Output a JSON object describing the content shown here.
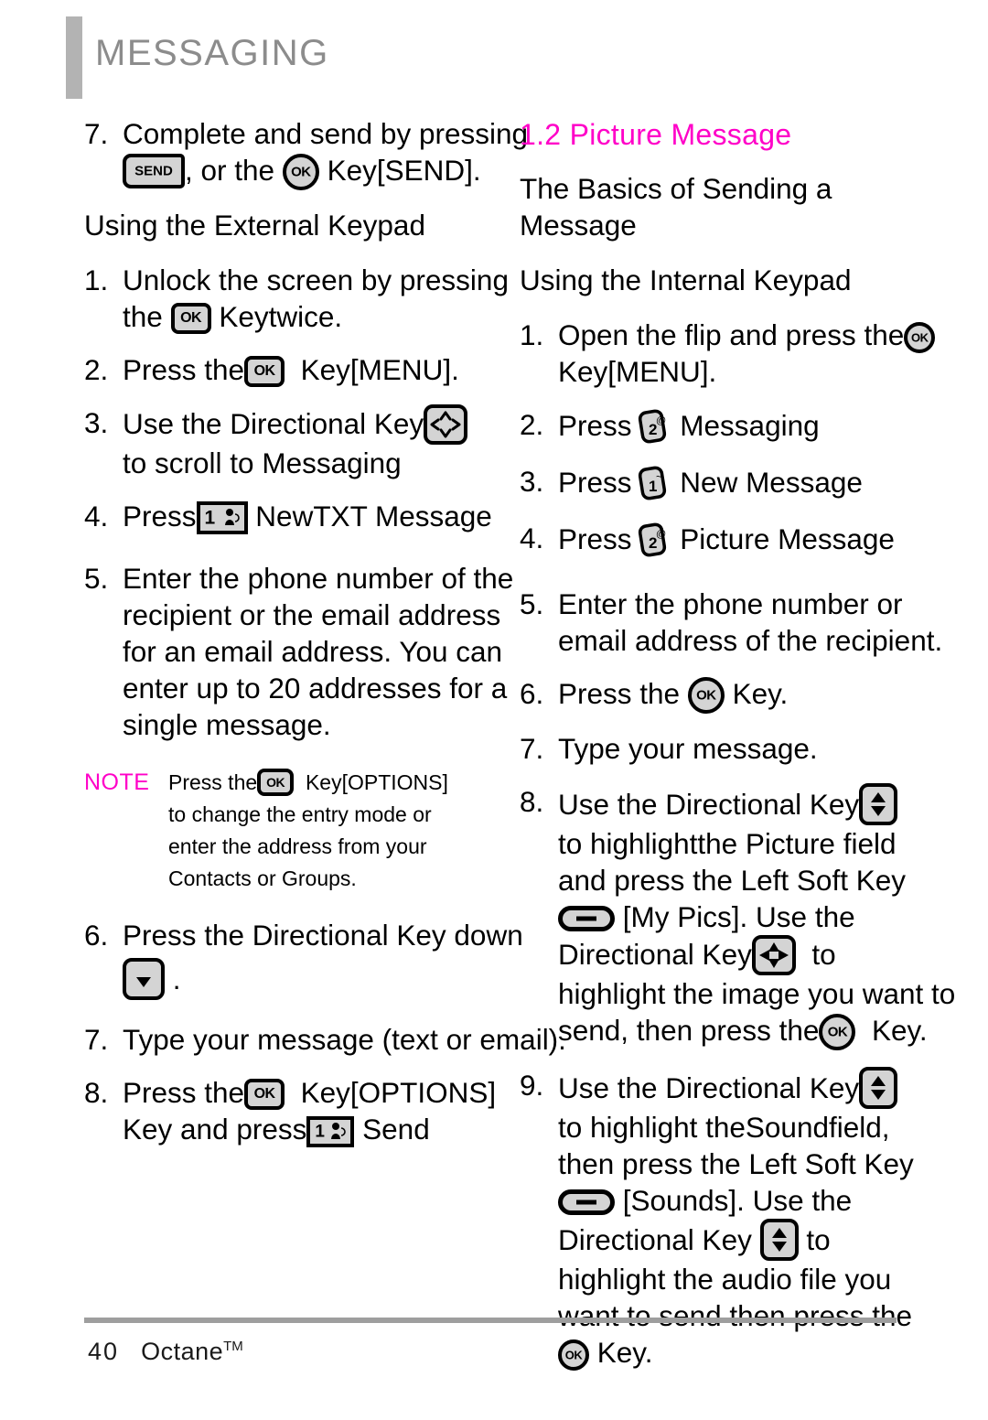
{
  "header": {
    "title": "MESSAGING"
  },
  "left_column": {
    "step7": {
      "num": "7.",
      "line1": "Complete and send by pressing",
      "line2_a": ", or the",
      "line2_b": "Key",
      "line2_c": "[SEND].",
      "key_send": "SEND",
      "key_ok": "OK"
    },
    "subheading": "Using the External Keypad",
    "step1": {
      "num": "1.",
      "line1": "Unlock the screen by pressing",
      "line2_a": "the",
      "line2_b": "Key",
      "line2_c": "twice.",
      "key_ok": "OK"
    },
    "step2": {
      "num": "2.",
      "line1_a": "Press the",
      "line1_b": "Key",
      "line1_c": "[MENU].",
      "key_ok": "OK"
    },
    "step3": {
      "num": "3.",
      "line1": "Use the Directional Key",
      "line2_a": "to scroll to",
      "line2_b": "Messaging"
    },
    "step4": {
      "num": "4.",
      "line1_a": "Press",
      "line1_b": "New",
      "line1_c": "TXT Message",
      "key_digit": "1"
    },
    "step5": {
      "num": "5.",
      "line1": "Enter the phone number of the",
      "line2": "recipient or the email address",
      "line3": "for an email address. You can",
      "line4": "enter up to 20 addresses for a",
      "line5": "single message."
    },
    "note": {
      "label": "NOTE",
      "line1_a": "Press the",
      "line1_b": "Key",
      "line1_c": "[OPTIONS]",
      "line2": "to change the entry mode or",
      "line3": "enter the address from your",
      "line4": "Contacts or Groups.",
      "key_ok": "OK"
    },
    "step6": {
      "num": "6.",
      "line1": "Press the Directional Key down",
      "line2": "."
    },
    "step7b": {
      "num": "7.",
      "line1": "Type your message (text or email)."
    },
    "step8": {
      "num": "8.",
      "line1_a": "Press the",
      "line1_b": "Key",
      "line1_c": "[OPTIONS]",
      "line2_a": "Key and press",
      "line2_b": "Send",
      "key_ok": "OK",
      "key_digit": "1"
    }
  },
  "right_column": {
    "section_title": "1.2 Picture Message",
    "heading1": "The Basics of Sending a Message",
    "heading2": "Using the Internal Keypad",
    "step1": {
      "num": "1.",
      "line1": "Open the flip and press the",
      "line2_a": "Key",
      "line2_b": "[MENU].",
      "key_ok": "OK"
    },
    "step2": {
      "num": "2.",
      "line1_a": "Press",
      "line1_b": "Messaging",
      "key_digit": "2",
      "key_alt": "@"
    },
    "step3": {
      "num": "3.",
      "line1_a": "Press",
      "line1_b": "New Message",
      "key_digit": "1",
      "key_alt": "~"
    },
    "step4": {
      "num": "4.",
      "line1_a": "Press",
      "line1_b": "Picture Message",
      "key_digit": "2",
      "key_alt": "@"
    },
    "step5": {
      "num": "5.",
      "line1": "Enter the phone number or",
      "line2": "email address of the recipient."
    },
    "step6": {
      "num": "6.",
      "line1_a": "Press the",
      "line1_b": "Key.",
      "key_ok": "OK"
    },
    "step7": {
      "num": "7.",
      "line1": "Type your message."
    },
    "step8": {
      "num": "8.",
      "line1": "Use the Directional Key",
      "line2_a": "to highlight",
      "line2_b": "the Picture field",
      "line3": "and press the Left Soft Key",
      "line4_a": "[My Pics].",
      "line4_b": "Use the",
      "line5_a": "Directional Key",
      "line5_b": "to",
      "line6": "highlight the image you want to",
      "line7_a": "send, then press the",
      "line7_b": "Key.",
      "key_ok": "OK"
    },
    "step9": {
      "num": "9.",
      "line1": "Use the Directional Key",
      "line2_a": "to highlight the",
      "line2_b": "Sound",
      "line2_c": "field,",
      "line3": "then press the Left Soft Key",
      "line4_a": "[Sounds].",
      "line4_b": "Use the",
      "line5_a": "Directional Key",
      "line5_b": "to",
      "line6": "highlight the audio file you",
      "line7": "want to send then press the",
      "line8": "Key.",
      "key_ok": "OK"
    }
  },
  "footer": {
    "page": "40",
    "product": "Octane",
    "trademark": "TM"
  },
  "colors": {
    "accent_magenta": "#ff00c8",
    "header_gray": "#8c8c8c",
    "bar_gray": "#b3b3b3",
    "key_fill": "#d4d4d4"
  }
}
